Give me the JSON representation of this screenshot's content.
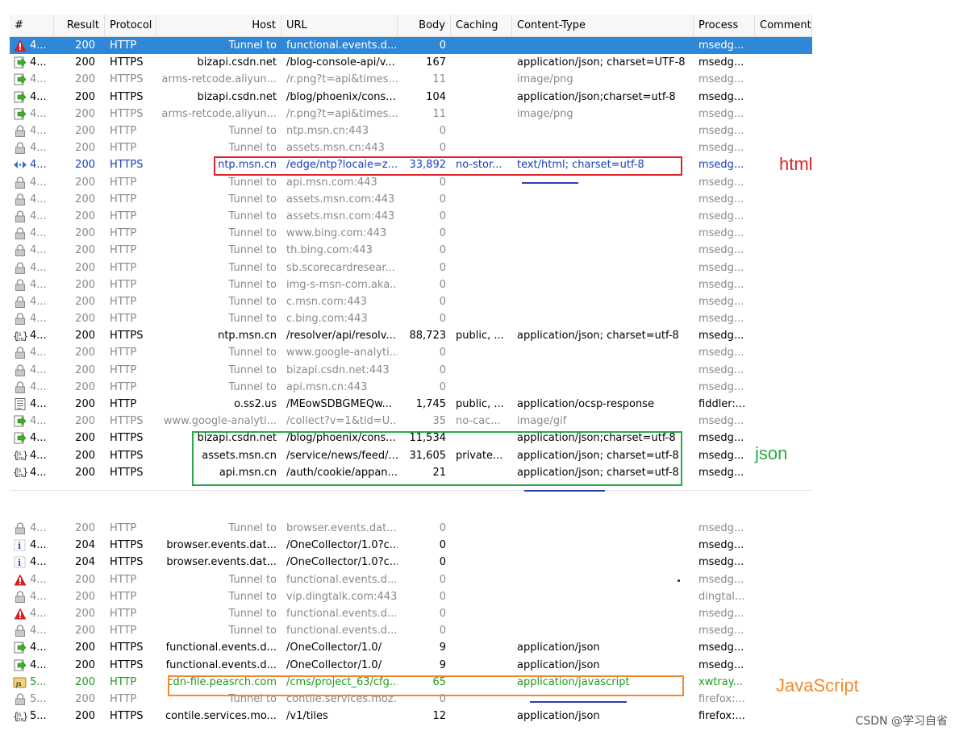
{
  "columns": [
    "#",
    "Result",
    "Protocol",
    "Host",
    "URL",
    "Body",
    "Caching",
    "Content-Type",
    "Process",
    "Comments"
  ],
  "rows_top": [
    {
      "icon": "warning-icon",
      "num": "4...",
      "result": "200",
      "protocol": "HTTP",
      "host": "Tunnel to",
      "url": "functional.events.d...",
      "body": "0",
      "caching": "",
      "ctype": "",
      "process": "msedg...",
      "style": "selected"
    },
    {
      "icon": "arrow-icon",
      "num": "4...",
      "result": "200",
      "protocol": "HTTPS",
      "host": "bizapi.csdn.net",
      "url": "/blog-console-api/v...",
      "body": "167",
      "caching": "",
      "ctype": "application/json; charset=UTF-8",
      "process": "msedg...",
      "style": "normal"
    },
    {
      "icon": "arrow-icon",
      "num": "4...",
      "result": "200",
      "protocol": "HTTPS",
      "host": "arms-retcode.aliyun...",
      "url": "/r.png?t=api&times...",
      "body": "11",
      "caching": "",
      "ctype": "image/png",
      "process": "msedg...",
      "style": "gray"
    },
    {
      "icon": "arrow-icon",
      "num": "4...",
      "result": "200",
      "protocol": "HTTPS",
      "host": "bizapi.csdn.net",
      "url": "/blog/phoenix/cons...",
      "body": "104",
      "caching": "",
      "ctype": "application/json;charset=utf-8",
      "process": "msedg...",
      "style": "normal"
    },
    {
      "icon": "arrow-icon",
      "num": "4...",
      "result": "200",
      "protocol": "HTTPS",
      "host": "arms-retcode.aliyun...",
      "url": "/r.png?t=api&times...",
      "body": "11",
      "caching": "",
      "ctype": "image/png",
      "process": "msedg...",
      "style": "gray"
    },
    {
      "icon": "lock-icon",
      "num": "4...",
      "result": "200",
      "protocol": "HTTP",
      "host": "Tunnel to",
      "url": "ntp.msn.cn:443",
      "body": "0",
      "caching": "",
      "ctype": "",
      "process": "msedg...",
      "style": "gray"
    },
    {
      "icon": "lock-icon",
      "num": "4...",
      "result": "200",
      "protocol": "HTTP",
      "host": "Tunnel to",
      "url": "assets.msn.cn:443",
      "body": "0",
      "caching": "",
      "ctype": "",
      "process": "msedg...",
      "style": "gray"
    },
    {
      "icon": "html-icon",
      "num": "4...",
      "result": "200",
      "protocol": "HTTPS",
      "host": "ntp.msn.cn",
      "url": "/edge/ntp?locale=z...",
      "body": "33,892",
      "caching": "no-stor...",
      "ctype": "text/html; charset=utf-8",
      "process": "msedg...",
      "style": "blue"
    },
    {
      "icon": "lock-icon",
      "num": "4...",
      "result": "200",
      "protocol": "HTTP",
      "host": "Tunnel to",
      "url": "api.msn.com:443",
      "body": "0",
      "caching": "",
      "ctype": "",
      "process": "msedg...",
      "style": "gray"
    },
    {
      "icon": "lock-icon",
      "num": "4...",
      "result": "200",
      "protocol": "HTTP",
      "host": "Tunnel to",
      "url": "assets.msn.com:443",
      "body": "0",
      "caching": "",
      "ctype": "",
      "process": "msedg...",
      "style": "gray"
    },
    {
      "icon": "lock-icon",
      "num": "4...",
      "result": "200",
      "protocol": "HTTP",
      "host": "Tunnel to",
      "url": "assets.msn.com:443",
      "body": "0",
      "caching": "",
      "ctype": "",
      "process": "msedg...",
      "style": "gray"
    },
    {
      "icon": "lock-icon",
      "num": "4...",
      "result": "200",
      "protocol": "HTTP",
      "host": "Tunnel to",
      "url": "www.bing.com:443",
      "body": "0",
      "caching": "",
      "ctype": "",
      "process": "msedg...",
      "style": "gray"
    },
    {
      "icon": "lock-icon",
      "num": "4...",
      "result": "200",
      "protocol": "HTTP",
      "host": "Tunnel to",
      "url": "th.bing.com:443",
      "body": "0",
      "caching": "",
      "ctype": "",
      "process": "msedg...",
      "style": "gray"
    },
    {
      "icon": "lock-icon",
      "num": "4...",
      "result": "200",
      "protocol": "HTTP",
      "host": "Tunnel to",
      "url": "sb.scorecardresear...",
      "body": "0",
      "caching": "",
      "ctype": "",
      "process": "msedg...",
      "style": "gray"
    },
    {
      "icon": "lock-icon",
      "num": "4...",
      "result": "200",
      "protocol": "HTTP",
      "host": "Tunnel to",
      "url": "img-s-msn-com.aka...",
      "body": "0",
      "caching": "",
      "ctype": "",
      "process": "msedg...",
      "style": "gray"
    },
    {
      "icon": "lock-icon",
      "num": "4...",
      "result": "200",
      "protocol": "HTTP",
      "host": "Tunnel to",
      "url": "c.msn.com:443",
      "body": "0",
      "caching": "",
      "ctype": "",
      "process": "msedg...",
      "style": "gray"
    },
    {
      "icon": "lock-icon",
      "num": "4...",
      "result": "200",
      "protocol": "HTTP",
      "host": "Tunnel to",
      "url": "c.bing.com:443",
      "body": "0",
      "caching": "",
      "ctype": "",
      "process": "msedg...",
      "style": "gray"
    },
    {
      "icon": "js-icon",
      "num": "4...",
      "result": "200",
      "protocol": "HTTPS",
      "host": "ntp.msn.cn",
      "url": "/resolver/api/resolv...",
      "body": "88,723",
      "caching": "public, ...",
      "ctype": "application/json; charset=utf-8",
      "process": "msedg...",
      "style": "normal"
    },
    {
      "icon": "lock-icon",
      "num": "4...",
      "result": "200",
      "protocol": "HTTP",
      "host": "Tunnel to",
      "url": "www.google-analyti...",
      "body": "0",
      "caching": "",
      "ctype": "",
      "process": "msedg...",
      "style": "gray"
    },
    {
      "icon": "lock-icon",
      "num": "4...",
      "result": "200",
      "protocol": "HTTP",
      "host": "Tunnel to",
      "url": "bizapi.csdn.net:443",
      "body": "0",
      "caching": "",
      "ctype": "",
      "process": "msedg...",
      "style": "gray"
    },
    {
      "icon": "lock-icon",
      "num": "4...",
      "result": "200",
      "protocol": "HTTP",
      "host": "Tunnel to",
      "url": "api.msn.cn:443",
      "body": "0",
      "caching": "",
      "ctype": "",
      "process": "msedg...",
      "style": "gray"
    },
    {
      "icon": "doc-icon",
      "num": "4...",
      "result": "200",
      "protocol": "HTTP",
      "host": "o.ss2.us",
      "url": "/MEowSDBGMEQw...",
      "body": "1,745",
      "caching": "public, ...",
      "ctype": "application/ocsp-response",
      "process": "fiddler:...",
      "style": "normal"
    },
    {
      "icon": "arrow-icon",
      "num": "4...",
      "result": "200",
      "protocol": "HTTPS",
      "host": "www.google-analyti...",
      "url": "/collect?v=1&tid=U...",
      "body": "35",
      "caching": "no-cac...",
      "ctype": "image/gif",
      "process": "msedg...",
      "style": "gray"
    },
    {
      "icon": "arrow-icon",
      "num": "4...",
      "result": "200",
      "protocol": "HTTPS",
      "host": "bizapi.csdn.net",
      "url": "/blog/phoenix/cons...",
      "body": "11,534",
      "caching": "",
      "ctype": "application/json;charset=utf-8",
      "process": "msedg...",
      "style": "normal"
    },
    {
      "icon": "js-icon",
      "num": "4...",
      "result": "200",
      "protocol": "HTTPS",
      "host": "assets.msn.cn",
      "url": "/service/news/feed/...",
      "body": "31,605",
      "caching": "private...",
      "ctype": "application/json; charset=utf-8",
      "process": "msedg...",
      "style": "normal"
    },
    {
      "icon": "js-icon",
      "num": "4...",
      "result": "200",
      "protocol": "HTTPS",
      "host": "api.msn.cn",
      "url": "/auth/cookie/appan...",
      "body": "21",
      "caching": "",
      "ctype": "application/json; charset=utf-8",
      "process": "msedg...",
      "style": "normal"
    }
  ],
  "rows_bottom": [
    {
      "icon": "lock-icon",
      "num": "4...",
      "result": "200",
      "protocol": "HTTP",
      "host": "Tunnel to",
      "url": "browser.events.dat...",
      "body": "0",
      "caching": "",
      "ctype": "",
      "process": "msedg...",
      "style": "gray"
    },
    {
      "icon": "info-icon",
      "num": "4...",
      "result": "204",
      "protocol": "HTTPS",
      "host": "browser.events.dat...",
      "url": "/OneCollector/1.0?c...",
      "body": "0",
      "caching": "",
      "ctype": "",
      "process": "msedg...",
      "style": "normal"
    },
    {
      "icon": "info-icon",
      "num": "4...",
      "result": "204",
      "protocol": "HTTPS",
      "host": "browser.events.dat...",
      "url": "/OneCollector/1.0?c...",
      "body": "0",
      "caching": "",
      "ctype": "",
      "process": "msedg...",
      "style": "normal"
    },
    {
      "icon": "warning-icon",
      "num": "4...",
      "result": "200",
      "protocol": "HTTP",
      "host": "Tunnel to",
      "url": "functional.events.d...",
      "body": "0",
      "caching": "",
      "ctype": "",
      "process": "msedg...",
      "style": "gray"
    },
    {
      "icon": "lock-icon",
      "num": "4...",
      "result": "200",
      "protocol": "HTTP",
      "host": "Tunnel to",
      "url": "vip.dingtalk.com:443",
      "body": "0",
      "caching": "",
      "ctype": "",
      "process": "dingtal...",
      "style": "gray"
    },
    {
      "icon": "warning-icon",
      "num": "4...",
      "result": "200",
      "protocol": "HTTP",
      "host": "Tunnel to",
      "url": "functional.events.d...",
      "body": "0",
      "caching": "",
      "ctype": "",
      "process": "msedg...",
      "style": "gray"
    },
    {
      "icon": "lock-icon",
      "num": "4...",
      "result": "200",
      "protocol": "HTTP",
      "host": "Tunnel to",
      "url": "functional.events.d...",
      "body": "0",
      "caching": "",
      "ctype": "",
      "process": "msedg...",
      "style": "gray"
    },
    {
      "icon": "arrow-icon",
      "num": "4...",
      "result": "200",
      "protocol": "HTTPS",
      "host": "functional.events.d...",
      "url": "/OneCollector/1.0/",
      "body": "9",
      "caching": "",
      "ctype": "application/json",
      "process": "msedg...",
      "style": "normal"
    },
    {
      "icon": "arrow-icon",
      "num": "4...",
      "result": "200",
      "protocol": "HTTPS",
      "host": "functional.events.d...",
      "url": "/OneCollector/1.0/",
      "body": "9",
      "caching": "",
      "ctype": "application/json",
      "process": "msedg...",
      "style": "normal"
    },
    {
      "icon": "script-icon",
      "num": "5...",
      "result": "200",
      "protocol": "HTTP",
      "host": "cdn-file.peasrch.com",
      "url": "/cms/project_63/cfg...",
      "body": "65",
      "caching": "",
      "ctype": "application/javascript",
      "process": "xwtray...",
      "style": "green"
    },
    {
      "icon": "lock-icon",
      "num": "5...",
      "result": "200",
      "protocol": "HTTP",
      "host": "Tunnel to",
      "url": "contile.services.moz...",
      "body": "0",
      "caching": "",
      "ctype": "",
      "process": "firefox:...",
      "style": "gray"
    },
    {
      "icon": "js-icon",
      "num": "5...",
      "result": "200",
      "protocol": "HTTPS",
      "host": "contile.services.mo...",
      "url": "/v1/tiles",
      "body": "12",
      "caching": "",
      "ctype": "application/json",
      "process": "firefox:...",
      "style": "normal"
    }
  ],
  "annotations": {
    "html": "html",
    "json": "json",
    "javascript": "JavaScript"
  },
  "colors": {
    "red": "#e0222b",
    "green": "#2aa84a",
    "orange": "#f08a2c",
    "blue": "#2a3fb3"
  },
  "watermark": "CSDN @学习自省"
}
